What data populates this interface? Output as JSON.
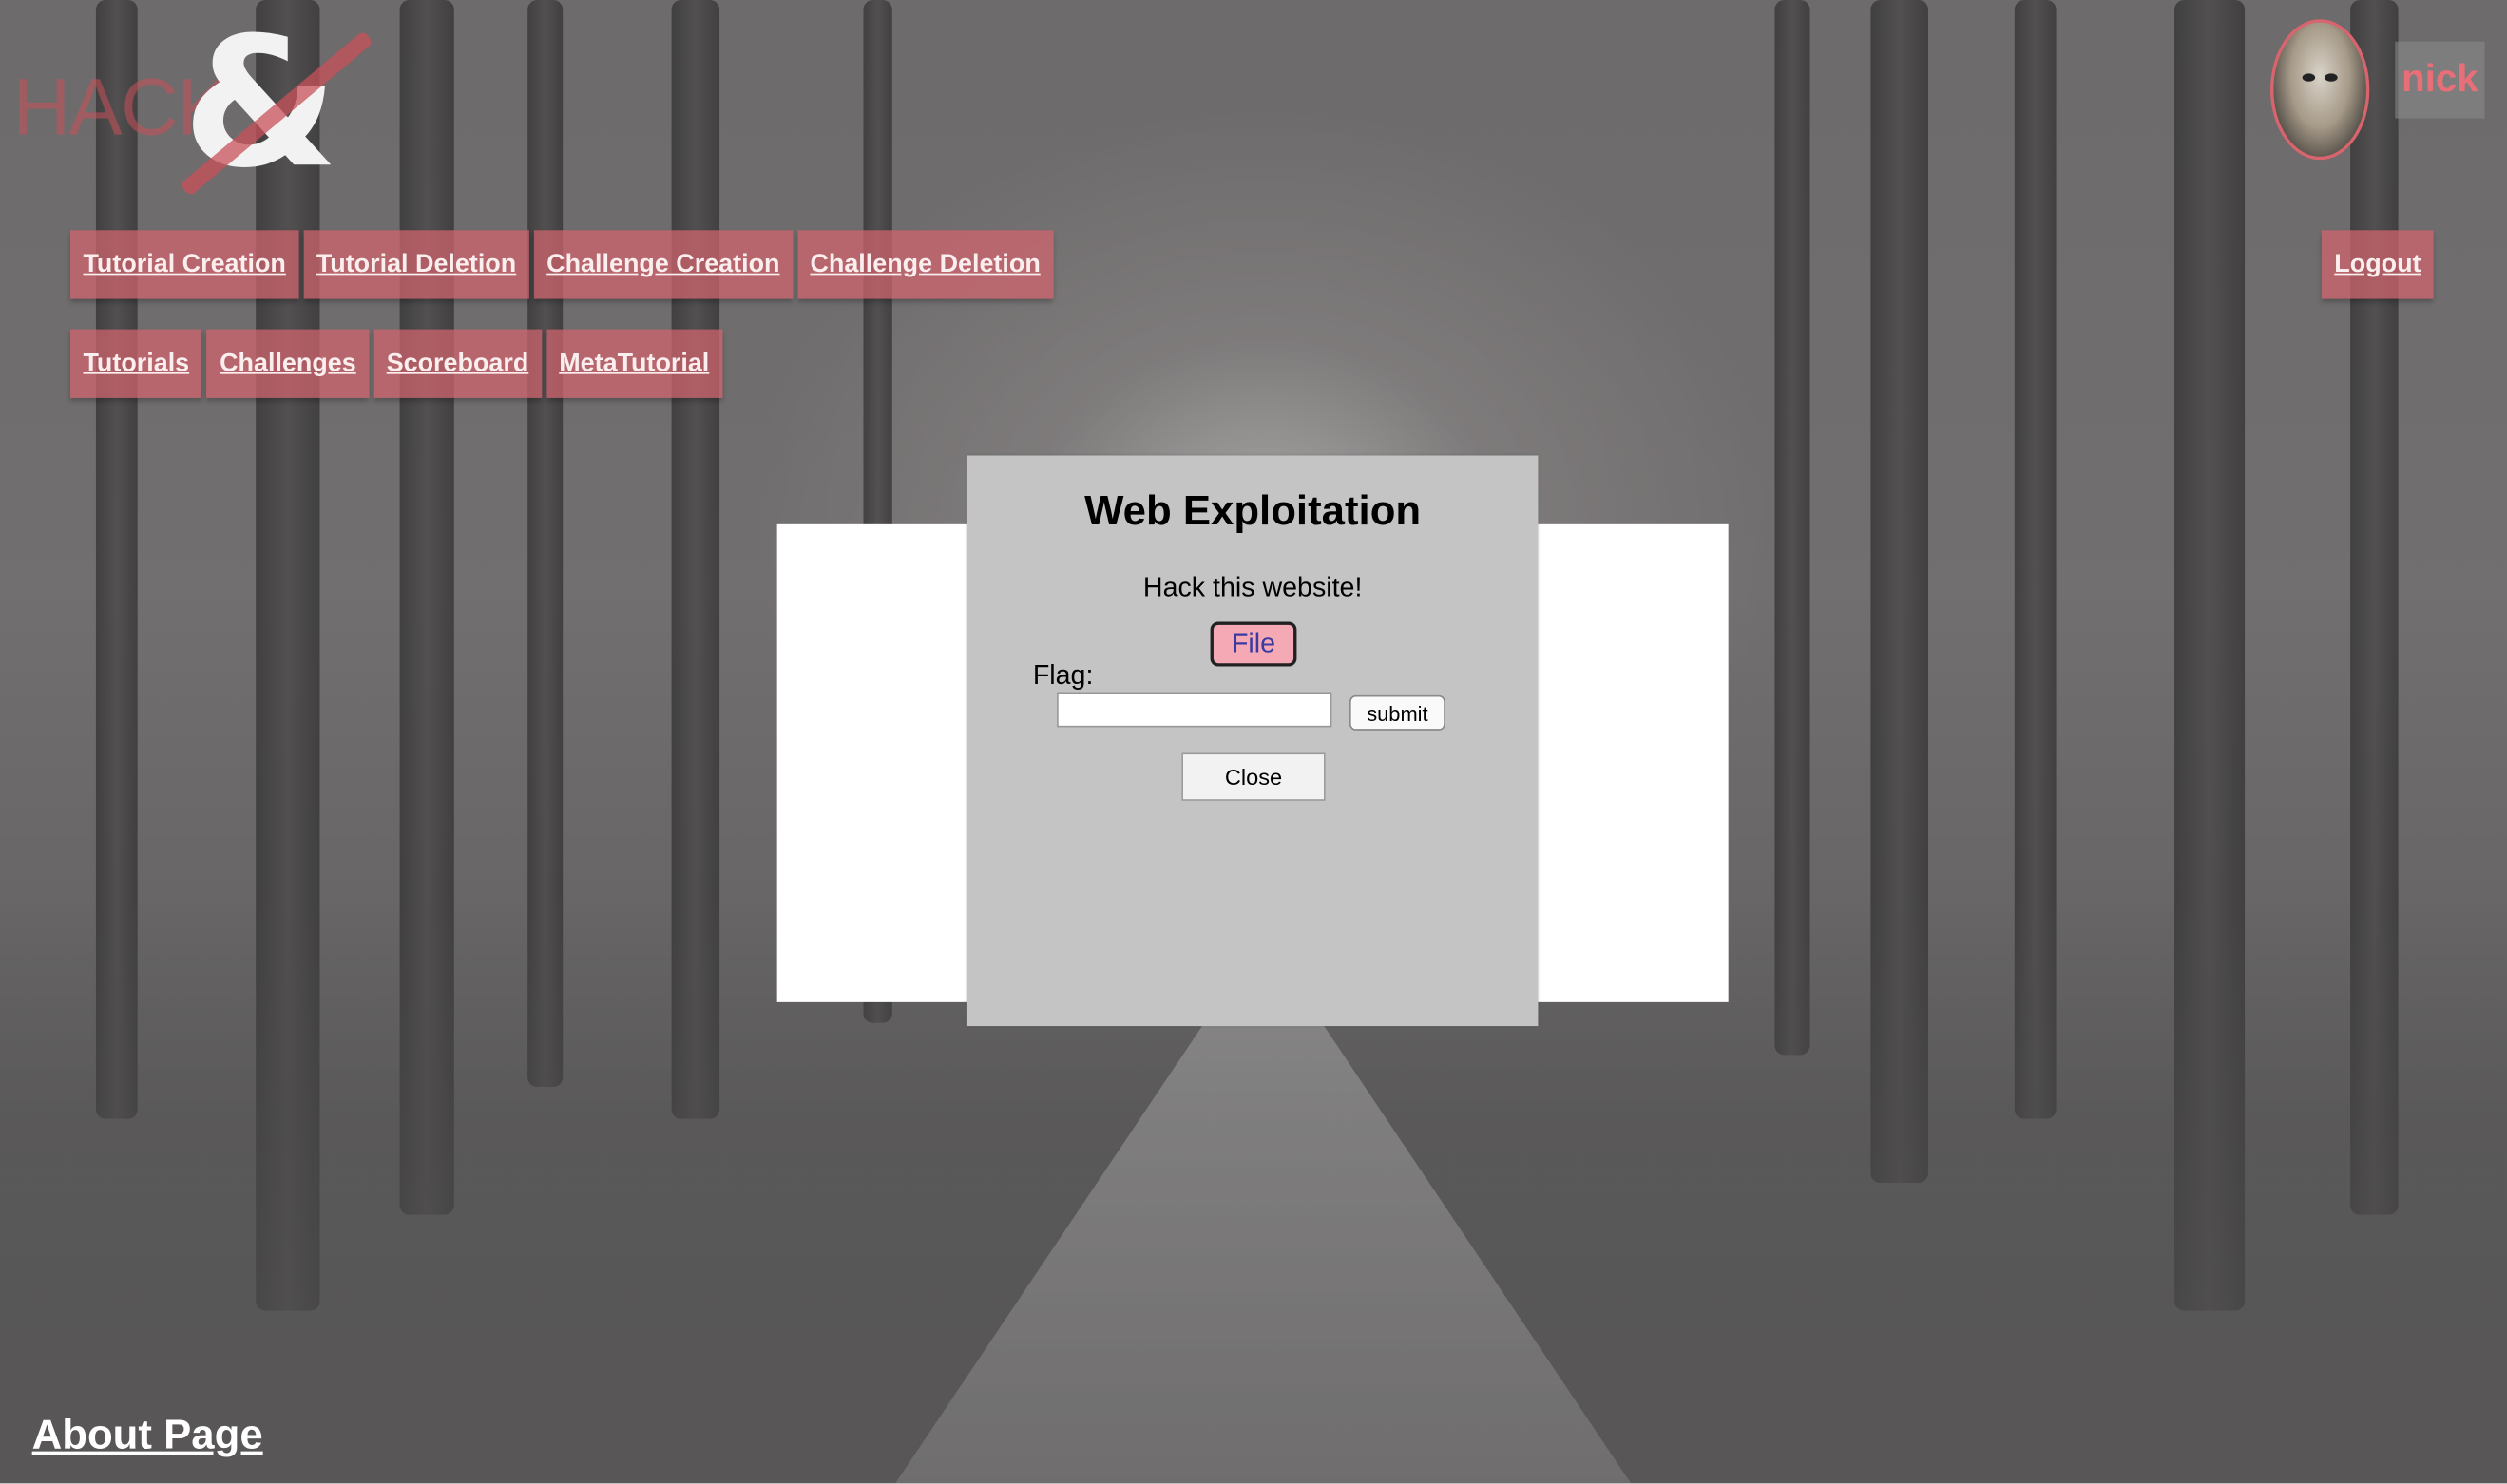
{
  "logo": {
    "text": "HACK",
    "symbol": "&"
  },
  "user": {
    "name": "nick",
    "avatar_icon": "hockey-mask-avatar-icon"
  },
  "nav": {
    "row1": [
      "Tutorial Creation",
      "Tutorial Deletion",
      "Challenge Creation",
      "Challenge Deletion"
    ],
    "row2": [
      "Tutorials",
      "Challenges",
      "Scoreboard",
      "MetaTutorial"
    ],
    "logout": "Logout"
  },
  "modal": {
    "title": "Web Exploitation",
    "description": "Hack this website!",
    "file_label": "File",
    "flag_label": "Flag:",
    "flag_value": "",
    "submit_label": "submit",
    "close_label": "Close"
  },
  "footer": {
    "about_label": "About Page"
  },
  "colors": {
    "accent": "#d2646e",
    "username": "#e86f78",
    "modal_bg": "#c4c4c4",
    "file_button": "#f4a9b5"
  }
}
